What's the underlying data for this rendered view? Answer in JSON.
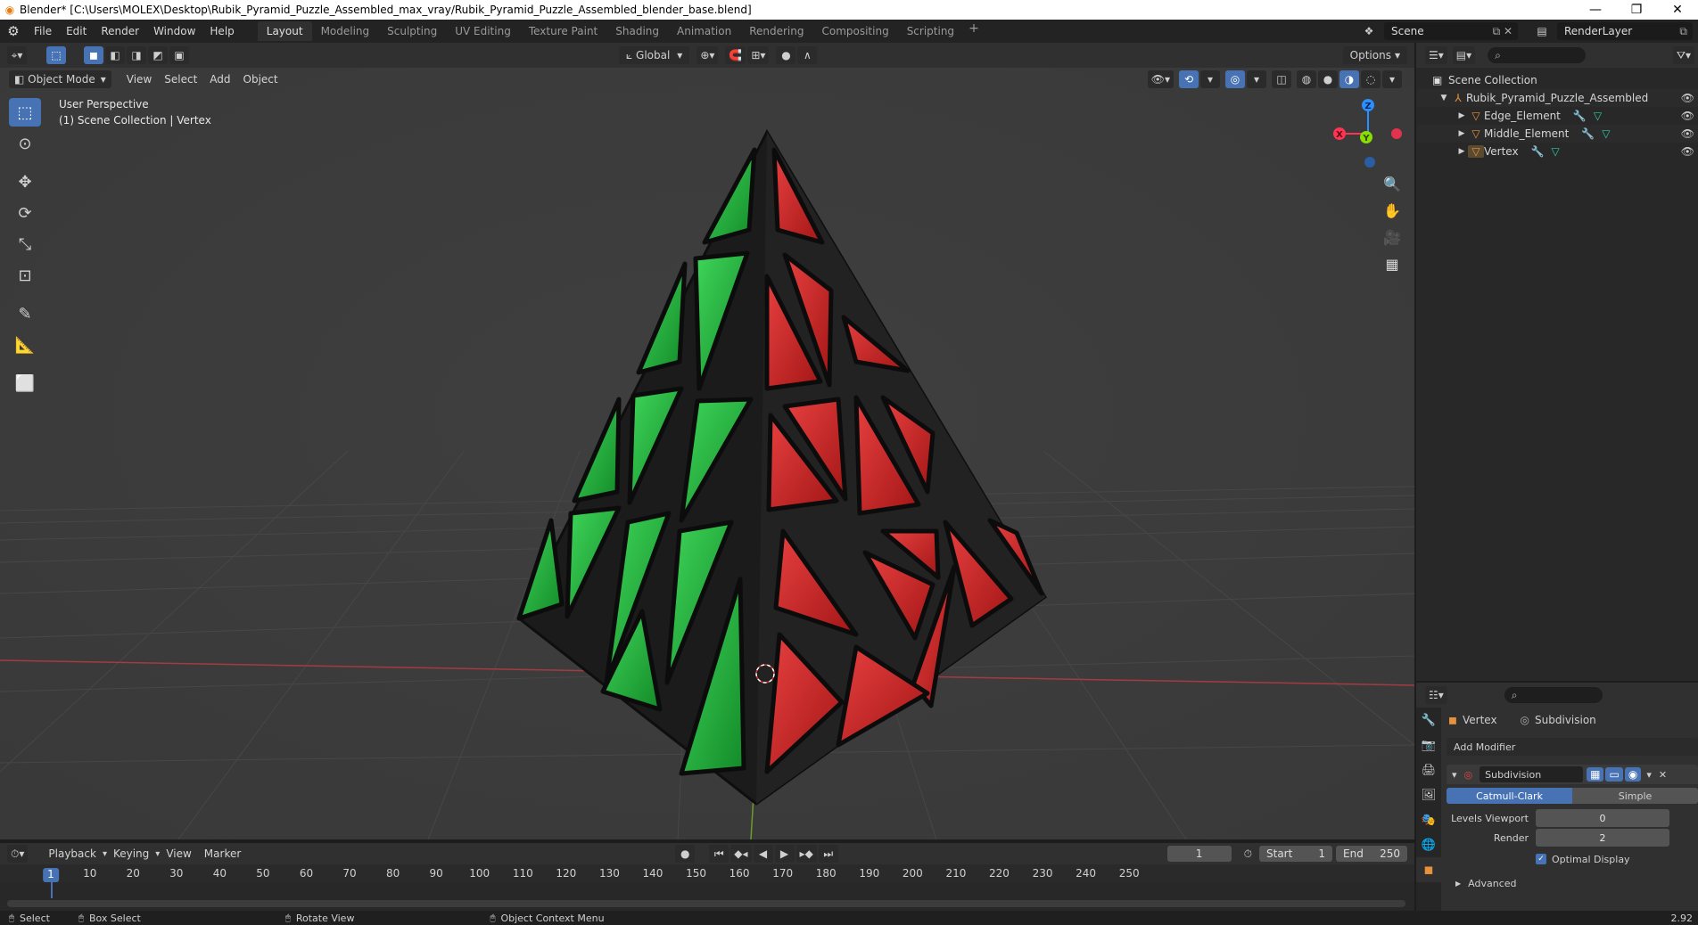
{
  "window": {
    "title": "Blender* [C:\\Users\\MOLEX\\Desktop\\Rubik_Pyramid_Puzzle_Assembled_max_vray/Rubik_Pyramid_Puzzle_Assembled_blender_base.blend]",
    "minimize": "—",
    "restore": "❐",
    "close": "✕"
  },
  "menu": [
    "File",
    "Edit",
    "Render",
    "Window",
    "Help"
  ],
  "workspaces": [
    "Layout",
    "Modeling",
    "Sculpting",
    "UV Editing",
    "Texture Paint",
    "Shading",
    "Animation",
    "Rendering",
    "Compositing",
    "Scripting"
  ],
  "workspace_add": "+",
  "scene": {
    "name": "Scene",
    "render_layer": "RenderLayer"
  },
  "viewport": {
    "transform_orientation": "Global",
    "options_label": "Options",
    "mode": "Object Mode",
    "header_menus": [
      "View",
      "Select",
      "Add",
      "Object"
    ],
    "info_line1": "User Perspective",
    "info_line2": "(1) Scene Collection | Vertex",
    "axis_labels": {
      "x": "X",
      "y": "Y",
      "z": "Z"
    }
  },
  "outliner": {
    "root": "Scene Collection",
    "collection": "Rubik_Pyramid_Puzzle_Assembled",
    "objects": [
      "Edge_Element",
      "Middle_Element",
      "Vertex"
    ]
  },
  "properties": {
    "object": "Vertex",
    "modifier_context": "Subdivision",
    "add_modifier": "Add Modifier",
    "modifier_name": "Subdivision",
    "algo_catmull": "Catmull-Clark",
    "algo_simple": "Simple",
    "levels_viewport_label": "Levels Viewport",
    "levels_viewport": "0",
    "render_label": "Render",
    "render_value": "2",
    "optimal_display": "Optimal Display",
    "advanced": "Advanced"
  },
  "timeline": {
    "menus": [
      "Playback",
      "Keying",
      "View",
      "Marker"
    ],
    "current_frame": "1",
    "start_label": "Start",
    "start": "1",
    "end_label": "End",
    "end": "250",
    "ruler": [
      "1",
      "10",
      "20",
      "30",
      "40",
      "50",
      "60",
      "70",
      "80",
      "90",
      "100",
      "110",
      "120",
      "130",
      "140",
      "150",
      "160",
      "170",
      "180",
      "190",
      "200",
      "210",
      "220",
      "230",
      "240",
      "250"
    ]
  },
  "status": {
    "select": "Select",
    "box_select": "Box Select",
    "rotate_view": "Rotate View",
    "context_menu": "Object Context Menu",
    "version": "2.92"
  },
  "colors": {
    "accent": "#4772b3",
    "sticker_green": "#22b83a",
    "sticker_red": "#d42a2a",
    "frame_black": "#1a1a1a",
    "axis_x": "#ff3352",
    "axis_y": "#8bdc00",
    "axis_z": "#2890ff"
  }
}
